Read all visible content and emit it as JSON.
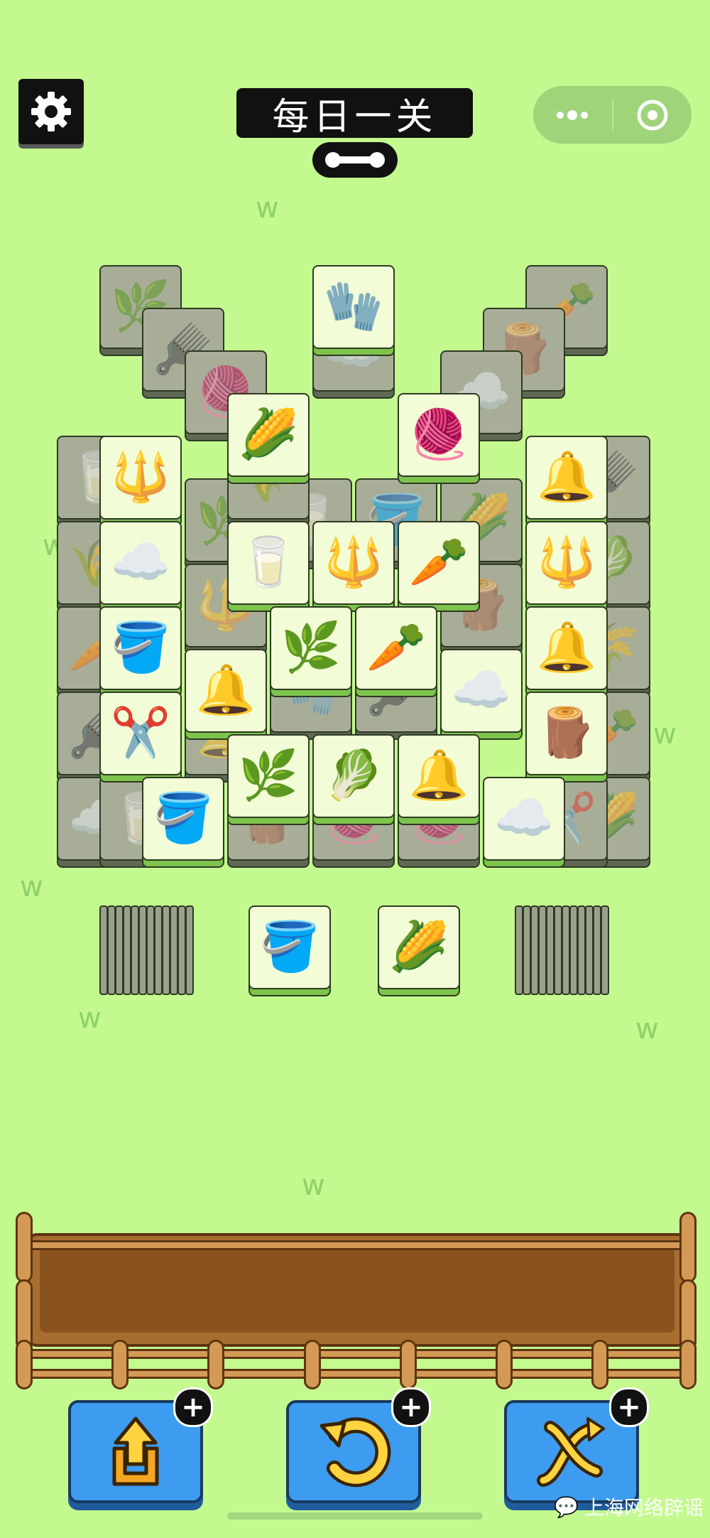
{
  "header": {
    "title": "每日一关",
    "settings_icon": "gear-icon",
    "progress_icon": "level-progress-icon",
    "menu_icon": "more-dots-icon",
    "close_icon": "target-close-icon"
  },
  "board": {
    "tile_icons": {
      "glove": "🧤",
      "grass": "🌿",
      "carrot": "🥕",
      "brush": "🪮",
      "stump": "🪵",
      "yarn": "🧶",
      "cotton": "☁️",
      "corn": "🌽",
      "pitchfork": "🔱",
      "bell": "🔔",
      "milk": "🥛",
      "bucket": "🪣",
      "clippers": "✂️",
      "cabbage": "🥬",
      "wheat": "🌾"
    }
  },
  "deck": {
    "left_top": "bucket",
    "right_top": "corn"
  },
  "tray": {
    "slots": 7
  },
  "powerups": [
    {
      "name": "move-out",
      "icon": "move-out-icon",
      "symbol": "⬆"
    },
    {
      "name": "undo",
      "icon": "undo-icon",
      "symbol": "↺"
    },
    {
      "name": "shuffle",
      "icon": "shuffle-icon",
      "symbol": "⇄"
    }
  ],
  "plus_label": "+",
  "watermark": "上海网络辟谣"
}
